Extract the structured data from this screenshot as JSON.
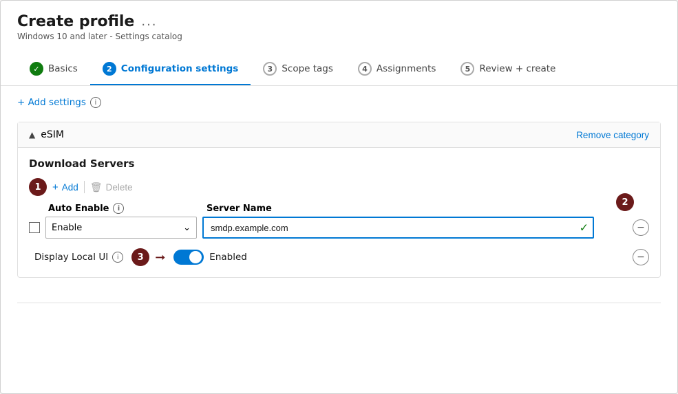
{
  "window": {
    "title": "Create profile",
    "subtitle": "Windows 10 and later - Settings catalog",
    "ellipsis": "..."
  },
  "tabs": [
    {
      "id": "basics",
      "num": "1",
      "label": "Basics",
      "state": "completed"
    },
    {
      "id": "config",
      "num": "2",
      "label": "Configuration settings",
      "state": "active"
    },
    {
      "id": "scope",
      "num": "3",
      "label": "Scope tags",
      "state": "default"
    },
    {
      "id": "assignments",
      "num": "4",
      "label": "Assignments",
      "state": "default"
    },
    {
      "id": "review",
      "num": "5",
      "label": "Review + create",
      "state": "default"
    }
  ],
  "add_settings": {
    "label": "+ Add settings",
    "info": "i"
  },
  "category": {
    "name": "eSIM",
    "remove_label": "Remove category"
  },
  "download_servers": {
    "title": "Download Servers",
    "add_label": "Add",
    "delete_label": "Delete",
    "col_auto_enable": "Auto Enable",
    "col_server_name": "Server Name",
    "row": {
      "enable_value": "Enable",
      "server_name_value": "smdp.example.com"
    }
  },
  "display_local": {
    "label": "Display Local UI",
    "info": "i",
    "toggle_label": "Enabled"
  },
  "annotations": {
    "num1": "1",
    "num2": "2",
    "num3": "3"
  }
}
